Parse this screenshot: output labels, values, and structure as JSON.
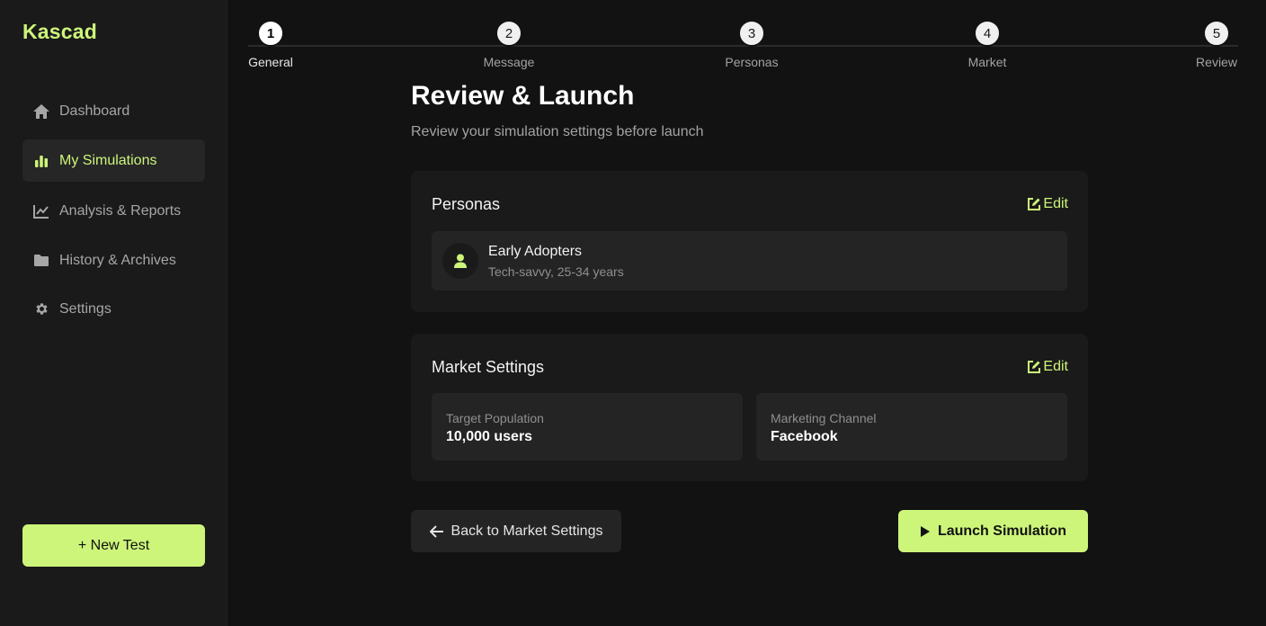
{
  "app": {
    "name": "Kascad",
    "accent": "#cdf57a"
  },
  "sidebar": {
    "items": [
      {
        "label": "Dashboard",
        "icon": "home-icon"
      },
      {
        "label": "My Simulations",
        "icon": "bar-chart-icon",
        "active": true
      },
      {
        "label": "Analysis & Reports",
        "icon": "line-chart-icon"
      },
      {
        "label": "History & Archives",
        "icon": "folder-icon"
      },
      {
        "label": "Settings",
        "icon": "gear-icon"
      }
    ],
    "new_test_label": "+ New Test"
  },
  "stepper": {
    "steps": [
      {
        "number": "1",
        "label": "General",
        "active": true
      },
      {
        "number": "2",
        "label": "Message"
      },
      {
        "number": "3",
        "label": "Personas"
      },
      {
        "number": "4",
        "label": "Market"
      },
      {
        "number": "5",
        "label": "Review"
      }
    ]
  },
  "main": {
    "title": "Review & Launch",
    "subtitle": "Review your simulation settings before launch",
    "personas_card": {
      "title": "Personas",
      "edit_label": "Edit",
      "persona": {
        "name": "Early Adopters",
        "description": "Tech-savvy, 25-34 years"
      }
    },
    "market_card": {
      "title": "Market Settings",
      "edit_label": "Edit",
      "stats": [
        {
          "label": "Target Population",
          "value": "10,000 users"
        },
        {
          "label": "Marketing Channel",
          "value": "Facebook"
        }
      ]
    },
    "back_label": "Back to Market Settings",
    "launch_label": "Launch Simulation"
  }
}
